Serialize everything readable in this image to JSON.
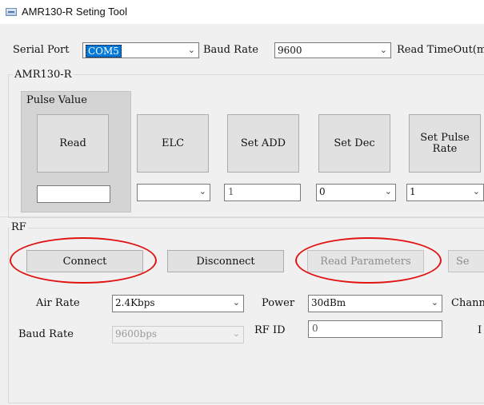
{
  "window": {
    "title": "AMR130-R  Seting Tool",
    "icon": "app-icon"
  },
  "connection": {
    "serial_port_label": "Serial Port",
    "serial_port_value": "COM5",
    "baud_rate_label": "Baud Rate",
    "baud_rate_value": "9600",
    "timeout_label": "Read TimeOut(ms)"
  },
  "amr_group": {
    "title": "AMR130-R",
    "pulse_group_title": "Pulse Value",
    "buttons": {
      "read": "Read",
      "elc": "ELC",
      "set_add": "Set ADD",
      "set_dec": "Set Dec",
      "set_pulse_rate": "Set Pulse Rate"
    },
    "inputs": {
      "read_value": "",
      "elc_value": "",
      "set_add_value": "1",
      "set_dec_value": "0",
      "pulse_rate_value": "1"
    }
  },
  "rf_group": {
    "title": "RF",
    "buttons": {
      "connect": "Connect",
      "disconnect": "Disconnect",
      "read_parameters": "Read Parameters",
      "set_partial": "Se"
    },
    "air_rate_label": "Air Rate",
    "air_rate_value": "2.4Kbps",
    "power_label": "Power",
    "power_value": "30dBm",
    "channel_label_partial": "Chann",
    "baud_rate_label": "Baud Rate",
    "baud_rate_value": "9600bps",
    "rf_id_label": "RF  ID",
    "rf_id_value": "0",
    "partial_label_right": "I"
  },
  "colors": {
    "highlight_ellipse": "#e11313",
    "selection": "#0078d7"
  }
}
